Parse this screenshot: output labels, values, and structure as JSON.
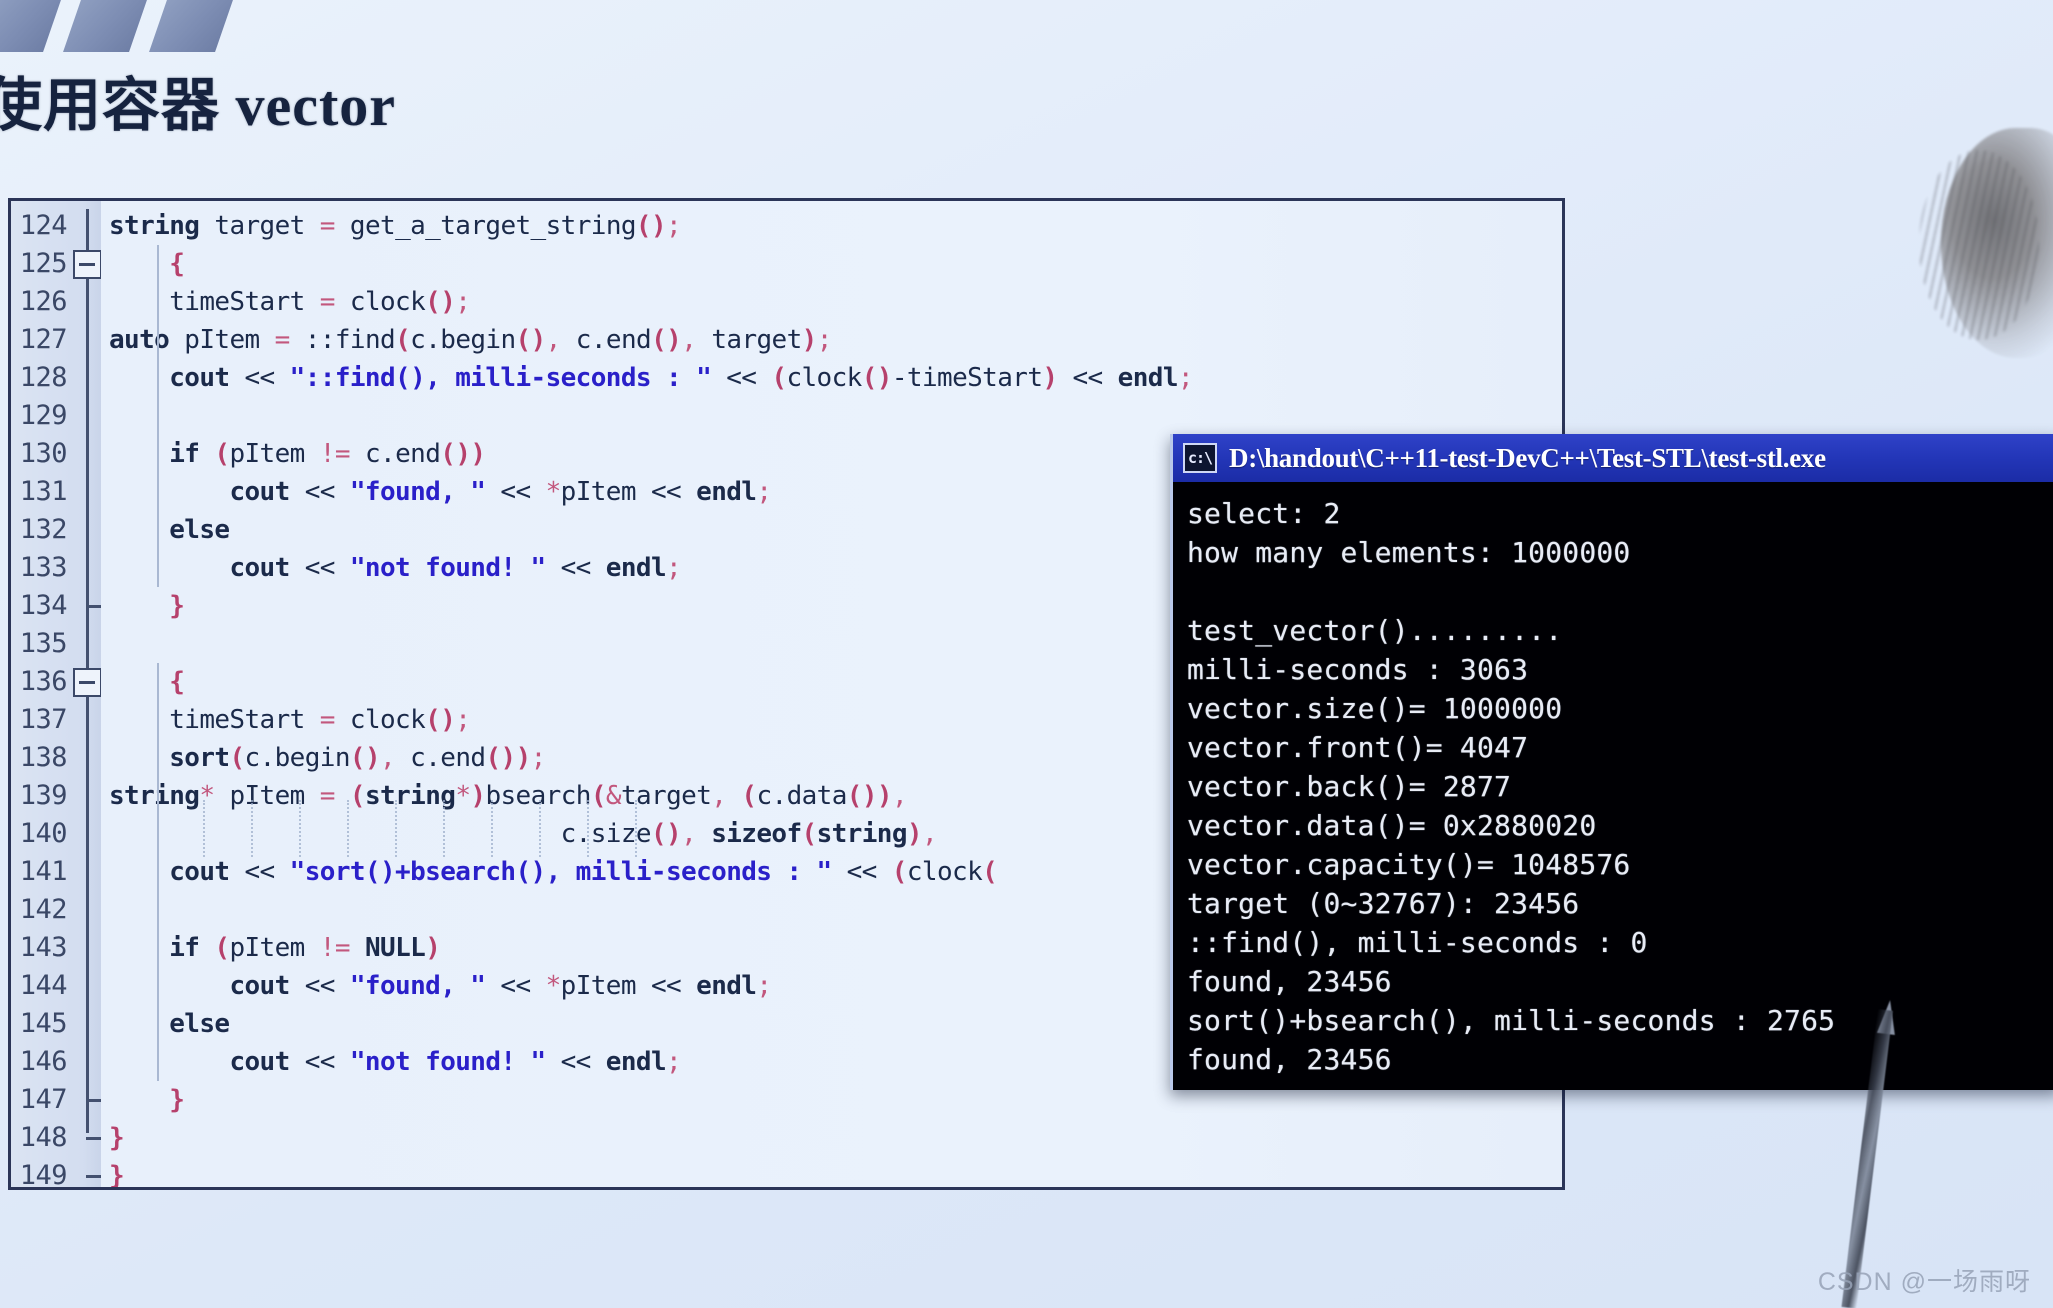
{
  "slide": {
    "title": "使用容器 vector",
    "watermark": "CSDN @一场雨呀",
    "accent_color": "#2336b8",
    "panel_border_color": "#2b3558",
    "code_bg_color": "#e9f1fb",
    "string_color": "#2a20c9",
    "punct_color": "#c2577d"
  },
  "decorations": {
    "bars": [
      "bar-1",
      "bar-2",
      "bar-3"
    ],
    "head_icon": "person-head-silhouette"
  },
  "editor": {
    "first_line_number": 124,
    "last_line_number": 149,
    "line_numbers": [
      124,
      125,
      126,
      127,
      128,
      129,
      130,
      131,
      132,
      133,
      134,
      135,
      136,
      137,
      138,
      139,
      140,
      141,
      142,
      143,
      144,
      145,
      146,
      147,
      148,
      149
    ],
    "fold_markers": [
      {
        "line": 125,
        "type": "collapse-box"
      },
      {
        "line": 136,
        "type": "collapse-box"
      },
      {
        "line": 134,
        "type": "fold-end-tick"
      },
      {
        "line": 147,
        "type": "fold-end-tick"
      },
      {
        "line": 148,
        "type": "fold-end-tick"
      },
      {
        "line": 149,
        "type": "fold-end-corner"
      }
    ],
    "lines": [
      {
        "n": 124,
        "text": "string target = get_a_target_string();"
      },
      {
        "n": 125,
        "text": "    {"
      },
      {
        "n": 126,
        "text": "    timeStart = clock();"
      },
      {
        "n": 127,
        "text": "auto pItem = ::find(c.begin(), c.end(), target);"
      },
      {
        "n": 128,
        "text": "    cout << \"::find(), milli-seconds : \" << (clock()-timeStart) << endl;"
      },
      {
        "n": 129,
        "text": ""
      },
      {
        "n": 130,
        "text": "    if (pItem != c.end())"
      },
      {
        "n": 131,
        "text": "        cout << \"found, \" << *pItem << endl;"
      },
      {
        "n": 132,
        "text": "    else"
      },
      {
        "n": 133,
        "text": "        cout << \"not found! \" << endl;"
      },
      {
        "n": 134,
        "text": "    }"
      },
      {
        "n": 135,
        "text": ""
      },
      {
        "n": 136,
        "text": "    {"
      },
      {
        "n": 137,
        "text": "    timeStart = clock();"
      },
      {
        "n": 138,
        "text": "    sort(c.begin(), c.end());"
      },
      {
        "n": 139,
        "text": "string* pItem = (string*)bsearch(&target, (c.data()),"
      },
      {
        "n": 140,
        "text": "                              c.size(), sizeof(string),"
      },
      {
        "n": 141,
        "text": "    cout << \"sort()+bsearch(), milli-seconds : \" << (clock("
      },
      {
        "n": 142,
        "text": ""
      },
      {
        "n": 143,
        "text": "    if (pItem != NULL)"
      },
      {
        "n": 144,
        "text": "        cout << \"found, \" << *pItem << endl;"
      },
      {
        "n": 145,
        "text": "    else"
      },
      {
        "n": 146,
        "text": "        cout << \"not found! \" << endl;"
      },
      {
        "n": 147,
        "text": "    }"
      },
      {
        "n": 148,
        "text": "}"
      },
      {
        "n": 149,
        "text": "}"
      }
    ]
  },
  "console": {
    "icon_label": "c:\\",
    "title": "D:\\handout\\C++11-test-DevC++\\Test-STL\\test-stl.exe",
    "output_lines": [
      "select: 2",
      "how many elements: 1000000",
      "",
      "test_vector().........",
      "milli-seconds : 3063",
      "vector.size()= 1000000",
      "vector.front()= 4047",
      "vector.back()= 2877",
      "vector.data()= 0x2880020",
      "vector.capacity()= 1048576",
      "target (0~32767): 23456",
      "::find(), milli-seconds : 0",
      "found, 23456",
      "sort()+bsearch(), milli-seconds : 2765",
      "found, 23456"
    ]
  }
}
